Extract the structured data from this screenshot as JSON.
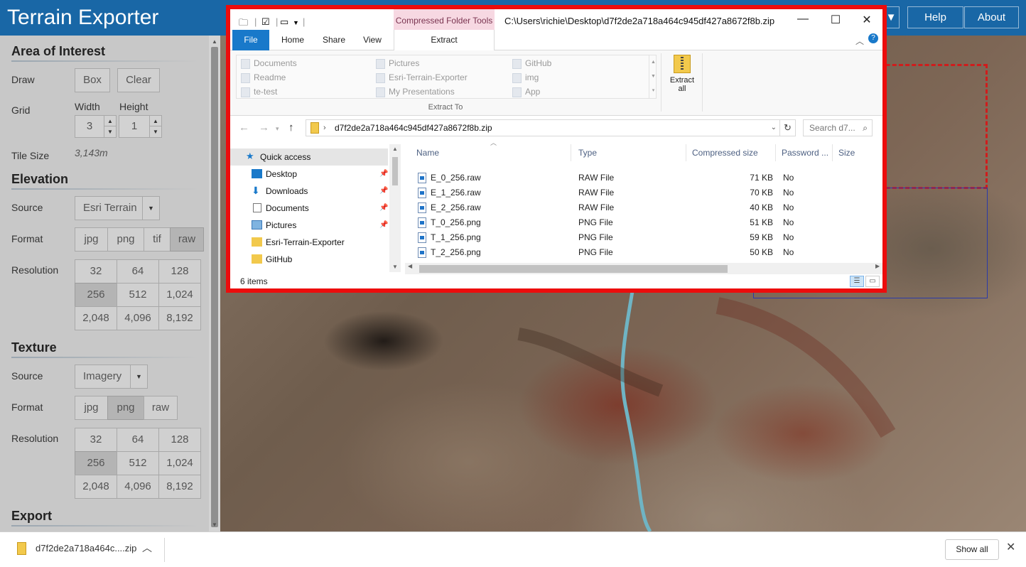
{
  "app": {
    "title": "Terrain Exporter",
    "nav": {
      "dropdown_icon": "caret-down-icon",
      "help": "Help",
      "about": "About"
    },
    "colors": {
      "topbar": "#1967a6",
      "aoi_outline": "#d01c1c",
      "tile_grid": "#2a3aa8",
      "explorer_border": "#ec0c0c"
    }
  },
  "sidebar": {
    "area_of_interest": {
      "title": "Area of Interest",
      "draw_label": "Draw",
      "box": "Box",
      "clear": "Clear",
      "grid_label": "Grid",
      "width_label": "Width",
      "height_label": "Height",
      "width_value": "3",
      "height_value": "1",
      "tile_size_label": "Tile Size",
      "tile_size_value": "3,143m"
    },
    "elevation": {
      "title": "Elevation",
      "source_label": "Source",
      "source_value": "Esri Terrain",
      "format_label": "Format",
      "formats": [
        "jpg",
        "png",
        "tif",
        "raw"
      ],
      "format_selected": "raw",
      "resolution_label": "Resolution",
      "resolutions": [
        "32",
        "64",
        "128",
        "256",
        "512",
        "1,024",
        "2,048",
        "4,096",
        "8,192"
      ],
      "resolution_selected": "256"
    },
    "texture": {
      "title": "Texture",
      "source_label": "Source",
      "source_value": "Imagery",
      "format_label": "Format",
      "formats": [
        "jpg",
        "png",
        "raw"
      ],
      "format_selected": "png",
      "resolution_label": "Resolution",
      "resolutions": [
        "32",
        "64",
        "128",
        "256",
        "512",
        "1,024",
        "2,048",
        "4,096",
        "8,192"
      ],
      "resolution_selected": "256"
    },
    "export": {
      "title": "Export"
    }
  },
  "explorer": {
    "title_path": "C:\\Users\\richie\\Desktop\\d7f2de2a718a464c945df427a8672f8b.zip",
    "context_tab": "Compressed Folder Tools",
    "tabs": [
      "File",
      "Home",
      "Share",
      "View",
      "Extract"
    ],
    "window_controls": {
      "minimize": "—",
      "maximize": "☐",
      "close": "✕"
    },
    "extract_to_items": [
      [
        "Documents",
        "Pictures",
        "GitHub"
      ],
      [
        "Readme",
        "Esri-Terrain-Exporter",
        "img"
      ],
      [
        "te-test",
        "My Presentations",
        "App"
      ]
    ],
    "extract_to_label": "Extract To",
    "extract_all_label": "Extract all",
    "address": "d7f2de2a718a464c945df427a8672f8b.zip",
    "search_placeholder": "Search d7...",
    "nav_pane": [
      {
        "label": "Quick access",
        "icon": "star-icon",
        "pinned": false,
        "selected": true
      },
      {
        "label": "Desktop",
        "icon": "desktop-icon",
        "pinned": true
      },
      {
        "label": "Downloads",
        "icon": "download-arrow-icon",
        "pinned": true
      },
      {
        "label": "Documents",
        "icon": "document-icon",
        "pinned": true
      },
      {
        "label": "Pictures",
        "icon": "pictures-icon",
        "pinned": true
      },
      {
        "label": "Esri-Terrain-Exporter",
        "icon": "folder-icon",
        "pinned": false
      },
      {
        "label": "GitHub",
        "icon": "folder-icon",
        "pinned": false
      }
    ],
    "columns": [
      "Name",
      "Type",
      "Compressed size",
      "Password ...",
      "Size"
    ],
    "files": [
      {
        "name": "E_0_256.raw",
        "type": "RAW File",
        "compressed": "71 KB",
        "password": "No"
      },
      {
        "name": "E_1_256.raw",
        "type": "RAW File",
        "compressed": "70 KB",
        "password": "No"
      },
      {
        "name": "E_2_256.raw",
        "type": "RAW File",
        "compressed": "40 KB",
        "password": "No"
      },
      {
        "name": "T_0_256.png",
        "type": "PNG File",
        "compressed": "51 KB",
        "password": "No"
      },
      {
        "name": "T_1_256.png",
        "type": "PNG File",
        "compressed": "59 KB",
        "password": "No"
      },
      {
        "name": "T_2_256.png",
        "type": "PNG File",
        "compressed": "50 KB",
        "password": "No"
      }
    ],
    "status": "6 items"
  },
  "download_shelf": {
    "file_name": "d7f2de2a718a464c....zip",
    "show_all": "Show all"
  }
}
